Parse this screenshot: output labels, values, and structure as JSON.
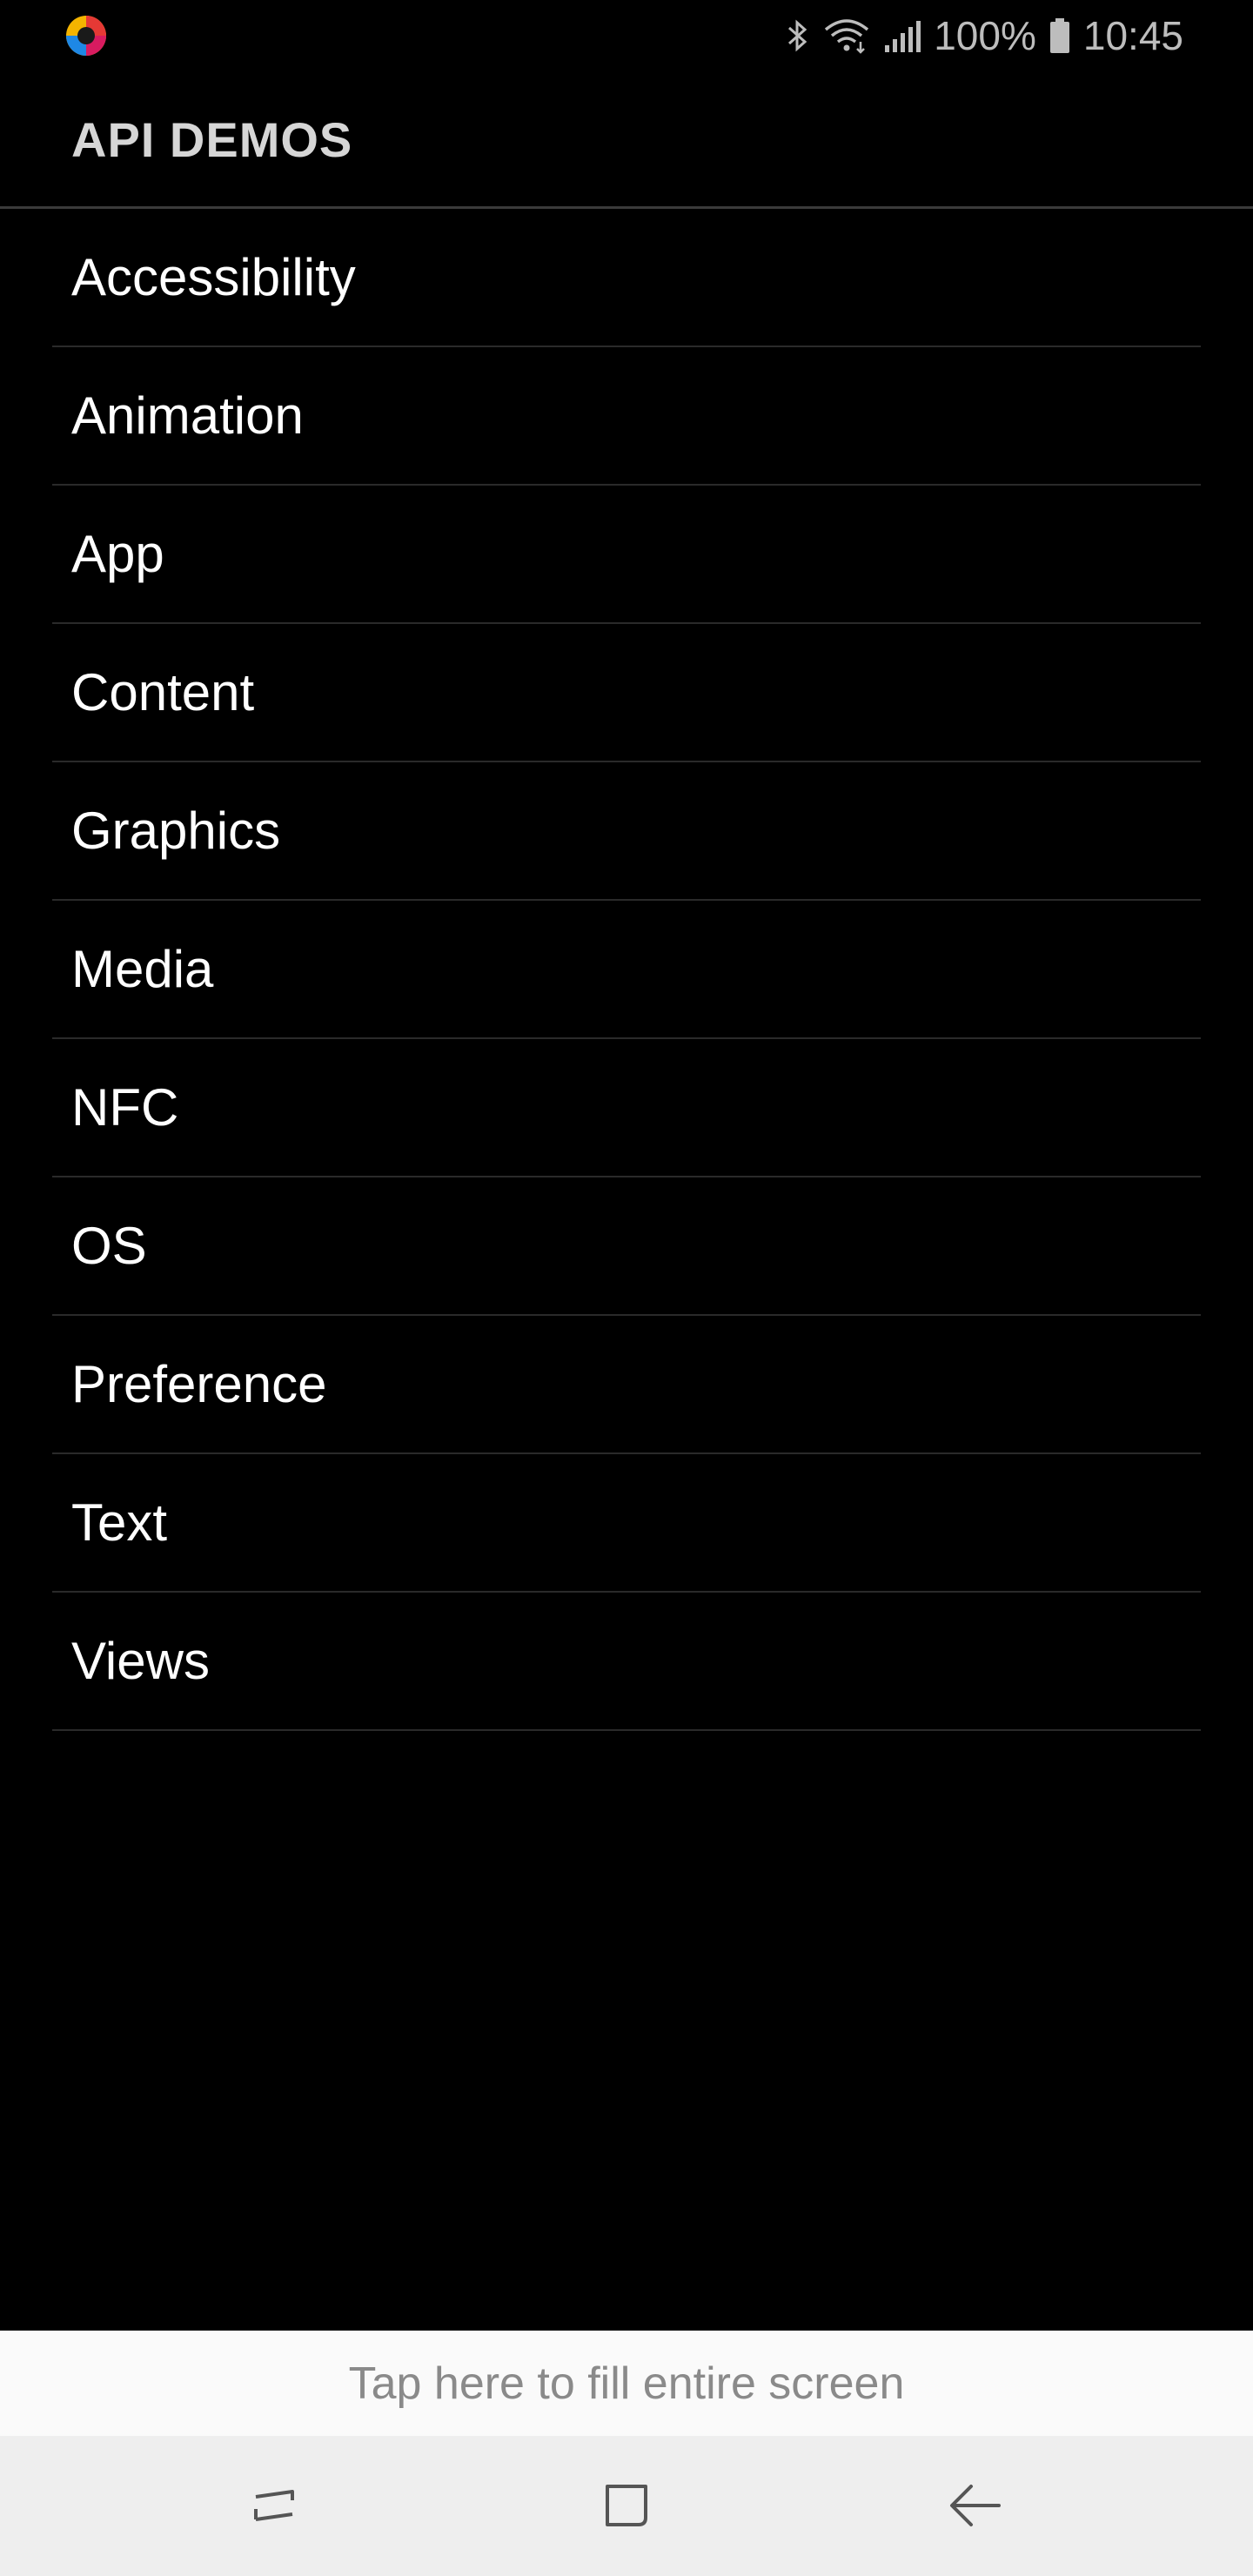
{
  "status_bar": {
    "battery_percent": "100%",
    "time": "10:45",
    "icons": [
      "app-logo-icon",
      "bluetooth-icon",
      "wifi-icon",
      "signal-icon",
      "battery-icon"
    ]
  },
  "title_bar": {
    "title": "API DEMOS"
  },
  "list": {
    "items": [
      {
        "label": "Accessibility"
      },
      {
        "label": "Animation"
      },
      {
        "label": "App"
      },
      {
        "label": "Content"
      },
      {
        "label": "Graphics"
      },
      {
        "label": "Media"
      },
      {
        "label": "NFC"
      },
      {
        "label": "OS"
      },
      {
        "label": "Preference"
      },
      {
        "label": "Text"
      },
      {
        "label": "Views"
      }
    ]
  },
  "fill_banner": {
    "text": "Tap here to fill entire screen"
  },
  "nav_bar": {
    "buttons": [
      "recents-icon",
      "home-icon",
      "back-icon"
    ]
  },
  "colors": {
    "background": "#000000",
    "text": "#ffffff",
    "title": "#d6d6d6",
    "divider": "#2a2a2a",
    "banner_bg": "#fafafa",
    "banner_text": "#8a8a8a",
    "nav_bg": "#eeeeee"
  }
}
